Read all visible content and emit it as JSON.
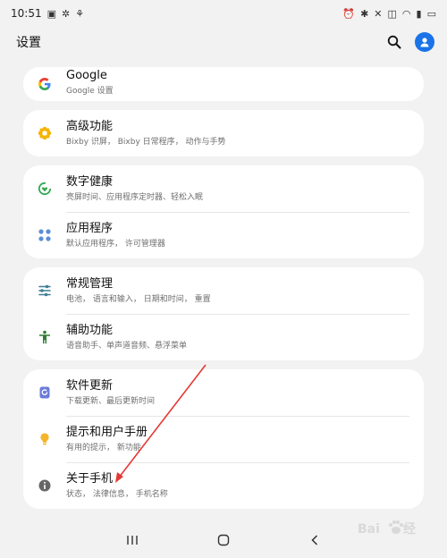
{
  "status_bar": {
    "time": "10:51"
  },
  "header": {
    "title": "设置"
  },
  "items": {
    "google": {
      "title": "Google",
      "subtitle": "Google 设置"
    },
    "advanced": {
      "title": "高级功能",
      "subtitle": "Bixby 识屏， Bixby 日常程序， 动作与手势"
    },
    "digital_wellbeing": {
      "title": "数字健康",
      "subtitle": "亮屏时间、应用程序定时器、轻松入眠"
    },
    "apps": {
      "title": "应用程序",
      "subtitle": "默认应用程序， 许可管理器"
    },
    "general": {
      "title": "常规管理",
      "subtitle": "电池， 语言和输入， 日期和时间， 重置"
    },
    "accessibility": {
      "title": "辅助功能",
      "subtitle": "语音助手、单声道音频、悬浮菜单"
    },
    "software_update": {
      "title": "软件更新",
      "subtitle": "下载更新、最后更新时间"
    },
    "tips": {
      "title": "提示和用户手册",
      "subtitle": "有用的提示， 新功能"
    },
    "about": {
      "title": "关于手机",
      "subtitle": "状态， 法律信息， 手机名称"
    }
  },
  "colors": {
    "accent": "#1a73e8",
    "annotation_arrow": "#e53935"
  },
  "icons": {
    "google": "google-g-icon",
    "advanced": "gear-flower-icon",
    "digital_wellbeing": "wellbeing-heart-icon",
    "apps": "apps-dots-icon",
    "general": "sliders-icon",
    "accessibility": "accessibility-person-icon",
    "software_update": "update-icon",
    "tips": "lightbulb-icon",
    "about": "info-icon"
  }
}
